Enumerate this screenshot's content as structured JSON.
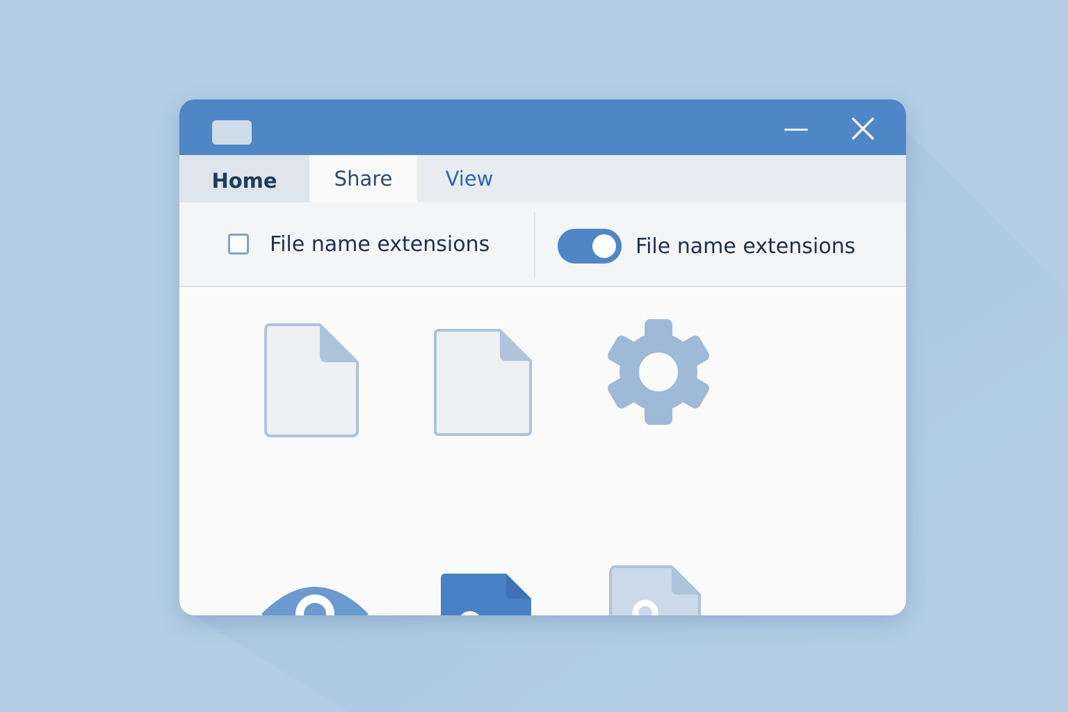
{
  "window": {
    "title_bar_color": "#4f86c6",
    "controls": {
      "minimize_icon": "minimize-icon",
      "close_icon": "close-icon"
    }
  },
  "tabs": [
    {
      "label": "Home"
    },
    {
      "label": "Share",
      "selected": true
    },
    {
      "label": "View"
    }
  ],
  "ribbon": {
    "checkbox_option": {
      "label": "File name extensions",
      "checked": false
    },
    "toggle_option": {
      "label": "File name extensions",
      "on": true
    }
  },
  "content": {
    "icons": [
      {
        "icon": "blank-document-icon"
      },
      {
        "icon": "blank-document-icon"
      },
      {
        "icon": "settings-gear-icon"
      },
      {
        "icon": "eye-icon"
      },
      {
        "icon": "p-document-icon"
      },
      {
        "icon": "locked-document-icon"
      }
    ]
  },
  "colors": {
    "accent": "#4f86c6",
    "background": "#b4cde4",
    "icon_muted": "#9fbad8"
  }
}
